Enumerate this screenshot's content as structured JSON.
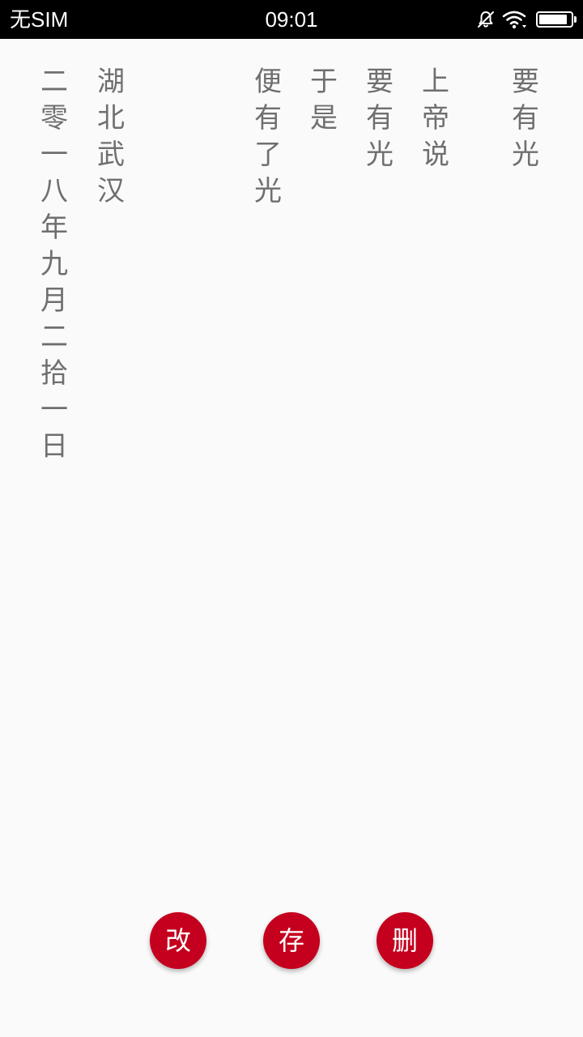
{
  "status_bar": {
    "carrier": "无SIM",
    "time": "09:01",
    "battery_level": 0.9,
    "icons": [
      "bell-off-icon",
      "wifi-icon",
      "battery-icon"
    ]
  },
  "poem": {
    "columns": [
      "要有光",
      "上帝说",
      "要有光",
      "于是",
      "便有了光",
      "湖北武汉",
      "二零一八年九月二拾一日"
    ]
  },
  "actions": {
    "edit_label": "改",
    "save_label": "存",
    "delete_label": "删"
  },
  "colors": {
    "status_bar_bg": "#000000",
    "page_bg": "#fafafa",
    "text": "#6f6f6f",
    "accent": "#c4001e"
  }
}
